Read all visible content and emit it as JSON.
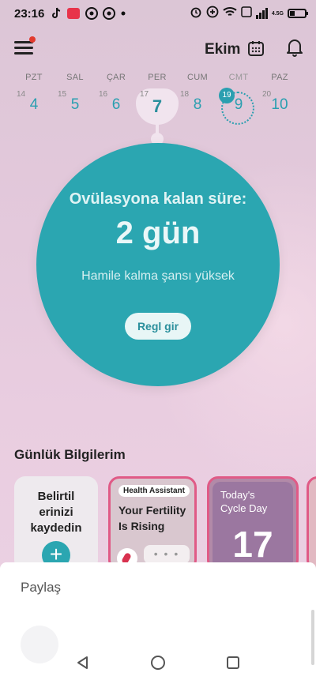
{
  "status_bar": {
    "time": "23:16",
    "network_badge": "4.5G",
    "icons": [
      "tiktok-icon",
      "app-icon",
      "chrome-icon",
      "chrome-icon",
      "dot-icon",
      "alarm-icon",
      "add-circle-icon",
      "wifi-icon",
      "volte-icon",
      "signal-icon",
      "battery-icon"
    ]
  },
  "header": {
    "month": "Ekim"
  },
  "week": {
    "days": [
      {
        "name": "PZT",
        "small": "14",
        "num": "4"
      },
      {
        "name": "SAL",
        "small": "15",
        "num": "5"
      },
      {
        "name": "ÇAR",
        "small": "16",
        "num": "6"
      },
      {
        "name": "PER",
        "small": "17",
        "num": "7"
      },
      {
        "name": "CUM",
        "small": "18",
        "num": "8"
      },
      {
        "name": "CMT",
        "small": "19",
        "num": "9"
      },
      {
        "name": "PAZ",
        "small": "20",
        "num": "10"
      }
    ]
  },
  "ovulation": {
    "title": "Ovülasyona kalan süre:",
    "value": "2 gün",
    "subtitle": "Hamile kalma şansı yüksek",
    "button": "Regl gir"
  },
  "daily_info": {
    "title": "Günlük Bilgilerim",
    "log_card": {
      "line1": "Belirtil",
      "line2": "erinizi",
      "line3": "kaydedin",
      "plus": "+"
    },
    "assistant_card": {
      "tag": "Health Assistant",
      "line1": "Your Fertility",
      "line2": "Is Rising",
      "dots": "• • •"
    },
    "cycle_card": {
      "line1": "Today's",
      "line2": "Cycle Day",
      "day": "17"
    }
  },
  "share_sheet": {
    "title": "Paylaş"
  },
  "colors": {
    "accent": "#2ba6b1",
    "card_border": "#e05a86",
    "background": "#e6cfe0"
  }
}
